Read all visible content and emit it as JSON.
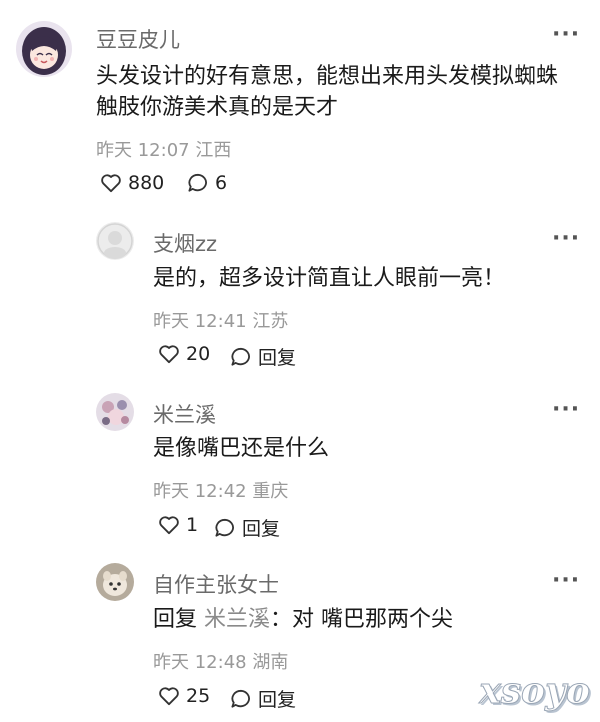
{
  "comments": [
    {
      "author": "豆豆皮儿",
      "text_line1": "头发设计的好有意思，能想出来用头发模拟蜘蛛",
      "text_line2": "触肢你游美术真的是天才",
      "meta": "昨天 12:07 江西",
      "likes": "880",
      "replies": "6"
    },
    {
      "author": "支烟zz",
      "text": "是的，超多设计简直让人眼前一亮！",
      "meta": "昨天 12:41 江苏",
      "likes": "20",
      "reply_label": "回复"
    },
    {
      "author": "米兰溪",
      "text": "是像嘴巴还是什么",
      "meta": "昨天 12:42 重庆",
      "likes": "1",
      "reply_label": "回复"
    },
    {
      "author": "自作主张女士",
      "reply_prefix": "回复",
      "reply_target": "米兰溪",
      "text": "：对 嘴巴那两个尖",
      "meta": "昨天 12:48 湖南",
      "likes": "25",
      "reply_label": "回复"
    }
  ],
  "more_icon": "···",
  "watermark": "xsoyo",
  "colors": {
    "name": "#6a6a6a",
    "meta": "#999999",
    "text": "#1a1a1a"
  }
}
